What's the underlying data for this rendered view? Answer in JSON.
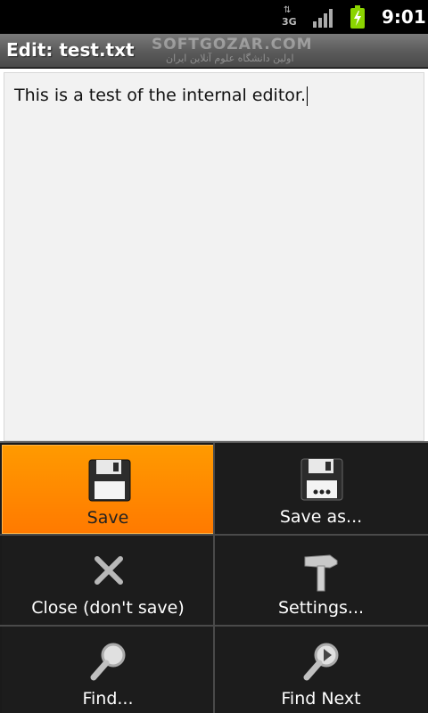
{
  "status_bar": {
    "network_type": "3G",
    "network_arrows": "⇅",
    "time": "9:01",
    "icons": [
      "3g-data-icon",
      "signal-strength-icon",
      "battery-charging-icon"
    ]
  },
  "title_bar": {
    "title": "Edit: test.txt",
    "watermark": "SOFTGOZAR.COM",
    "watermark_sub": "اولین دانشگاه علوم آنلاین ایران"
  },
  "editor": {
    "text": "This is a test of the internal editor."
  },
  "menu": {
    "items": [
      {
        "label": "Save",
        "icon": "floppy-disk-icon",
        "selected": true
      },
      {
        "label": "Save as...",
        "icon": "floppy-disk-dots-icon",
        "selected": false
      },
      {
        "label": "Close (don't save)",
        "icon": "close-x-icon",
        "selected": false
      },
      {
        "label": "Settings...",
        "icon": "hammer-icon",
        "selected": false
      },
      {
        "label": "Find...",
        "icon": "magnifier-icon",
        "selected": false
      },
      {
        "label": "Find Next",
        "icon": "magnifier-next-icon",
        "selected": false
      }
    ]
  },
  "colors": {
    "menu_selected": "#ff8a00",
    "menu_background": "#1c1c1c",
    "editor_background": "#f2f2f2"
  }
}
